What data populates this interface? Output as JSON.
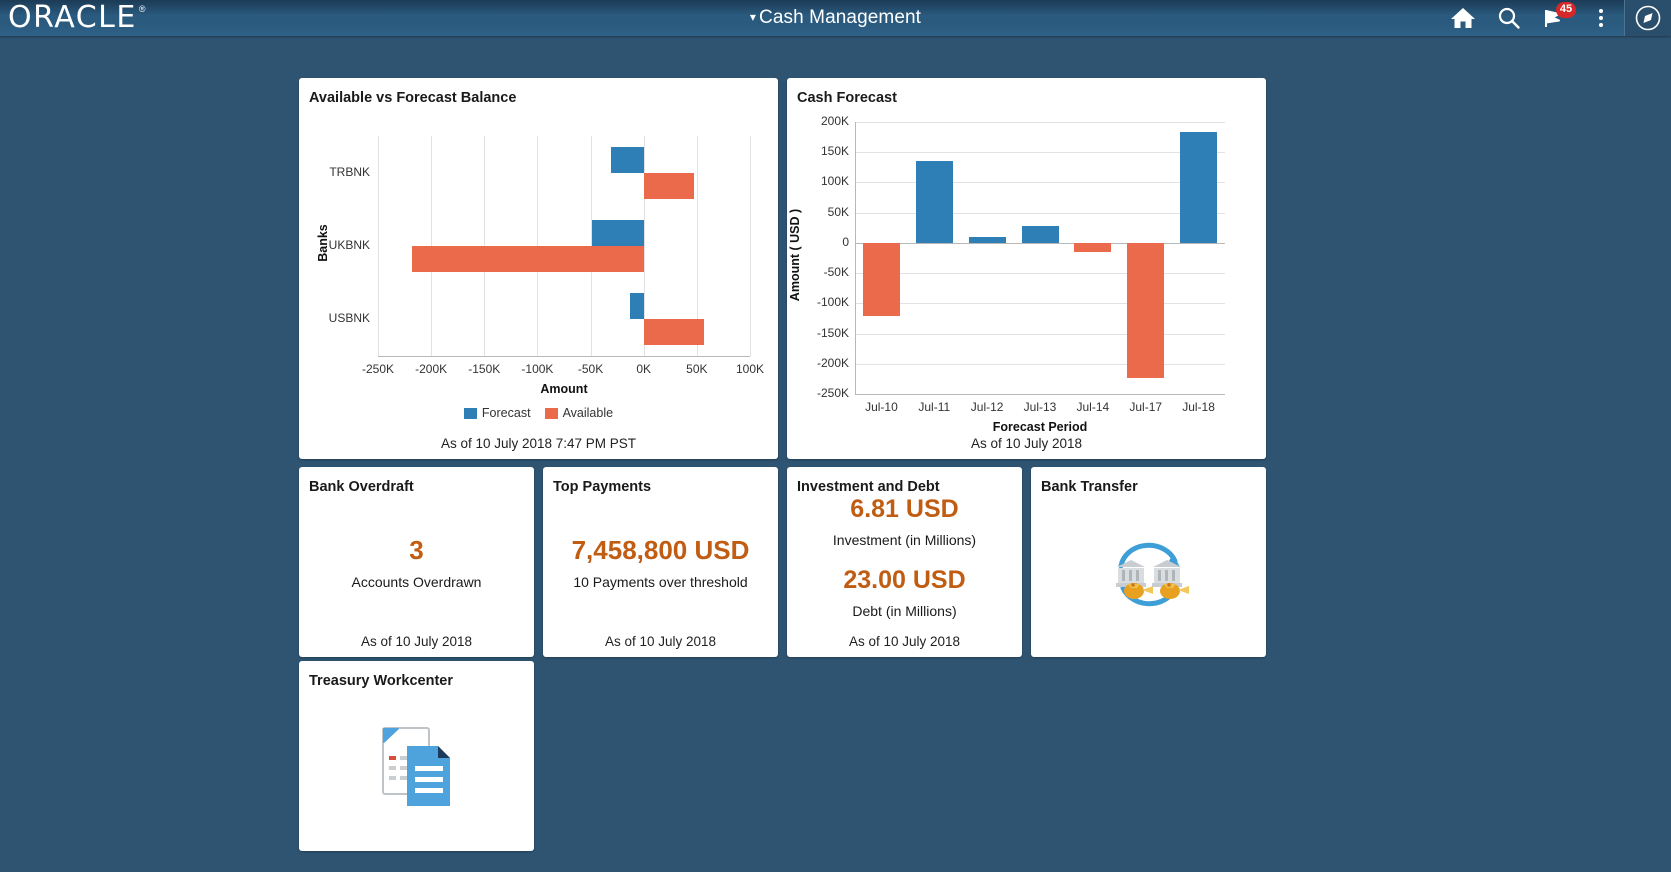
{
  "header": {
    "logo_text": "ORACLE",
    "logo_reg": "®",
    "title": "Cash Management",
    "title_caret": "▾",
    "icons": [
      {
        "name": "home-icon",
        "label": "Home"
      },
      {
        "name": "search-icon",
        "label": "Search"
      },
      {
        "name": "notifications-flag-icon",
        "label": "Notifications"
      },
      {
        "name": "actions-menu-icon",
        "label": "Actions"
      },
      {
        "name": "navigator-compass-icon",
        "label": "Navigator"
      }
    ],
    "notification_count": "45"
  },
  "colors": {
    "forecast_blue": "#2e7fb5",
    "available_orange": "#ec6a4c",
    "kpi_orange": "#c05d12",
    "header_blue": "#2b5b80",
    "page_bg": "#2e5472"
  },
  "tiles": {
    "available_vs_forecast": {
      "title": "Available vs Forecast Balance",
      "as_of": "As of 10 July 2018   7:47 PM PST"
    },
    "cash_forecast": {
      "title": "Cash Forecast",
      "as_of": "As of 10 July 2018"
    },
    "bank_overdraft": {
      "title": "Bank Overdraft",
      "value": "3",
      "label": "Accounts Overdrawn",
      "as_of": "As of 10 July 2018"
    },
    "top_payments": {
      "title": "Top Payments",
      "value": "7,458,800 USD",
      "label": "10 Payments over threshold",
      "as_of": "As of 10 July 2018"
    },
    "investment_and_debt": {
      "title": "Investment and Debt",
      "investment_value": "6.81 USD",
      "investment_label": "Investment (in Millions)",
      "debt_value": "23.00 USD",
      "debt_label": "Debt (in Millions)",
      "as_of": "As of 10 July 2018"
    },
    "bank_transfer": {
      "title": "Bank Transfer",
      "icon": "bank-transfer-icon"
    },
    "treasury_workcenter": {
      "title": "Treasury Workcenter",
      "icon": "documents-icon"
    }
  },
  "chart_data": [
    {
      "id": "available_vs_forecast",
      "type": "bar",
      "orientation": "horizontal",
      "title": "Available vs Forecast Balance",
      "xlabel": "Amount",
      "ylabel": "Banks",
      "categories": [
        "TRBNK",
        "UKBNK",
        "USBNK"
      ],
      "series": [
        {
          "name": "Forecast",
          "color": "#2e7fb5",
          "values": [
            -31000,
            -49000,
            -13000
          ]
        },
        {
          "name": "Available",
          "color": "#ec6a4c",
          "values": [
            47000,
            -218000,
            57000
          ]
        }
      ],
      "xlim": [
        -250000,
        100000
      ],
      "xticks": [
        -250000,
        -200000,
        -150000,
        -100000,
        -50000,
        0,
        50000,
        100000
      ],
      "xticklabels": [
        "-250K",
        "-200K",
        "-150K",
        "-100K",
        "-50K",
        "0K",
        "50K",
        "100K"
      ],
      "grid": true,
      "legend": "bottom",
      "legend_entries": [
        "Forecast",
        "Available"
      ]
    },
    {
      "id": "cash_forecast",
      "type": "bar",
      "orientation": "vertical",
      "title": "Cash Forecast",
      "xlabel": "Forecast Period",
      "ylabel": "Amount ( USD )",
      "categories": [
        "Jul-10",
        "Jul-11",
        "Jul-12",
        "Jul-13",
        "Jul-14",
        "Jul-17",
        "Jul-18"
      ],
      "values": [
        -121000,
        136000,
        9000,
        28000,
        -15000,
        -223000,
        183000
      ],
      "positive_color": "#2e7fb5",
      "negative_color": "#ec6a4c",
      "ylim": [
        -250000,
        200000
      ],
      "yticks": [
        200000,
        150000,
        100000,
        50000,
        0,
        -50000,
        -100000,
        -150000,
        -200000,
        -250000
      ],
      "yticklabels": [
        "200K",
        "150K",
        "100K",
        "50K",
        "0",
        "-50K",
        "-100K",
        "-150K",
        "-200K",
        "-250K"
      ],
      "grid": true,
      "legend": "none"
    }
  ]
}
